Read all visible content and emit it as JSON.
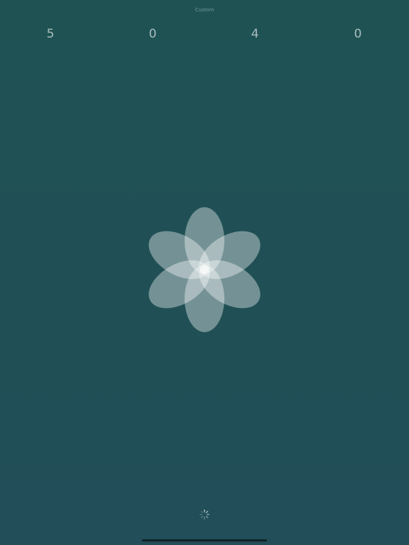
{
  "header": {
    "mode_label": "Custom"
  },
  "stats": [
    {
      "value": "5"
    },
    {
      "value": "0"
    },
    {
      "value": "4"
    },
    {
      "value": "0"
    }
  ],
  "flower": {
    "petal_color": "#ffffff",
    "petal_count": 6,
    "icon": "breathing-flower-icon"
  },
  "loader": {
    "icon": "activity-spinner-icon"
  },
  "colors": {
    "background_top": "#1f5253",
    "background_bottom": "#214e58",
    "text": "#a3bcbf"
  }
}
